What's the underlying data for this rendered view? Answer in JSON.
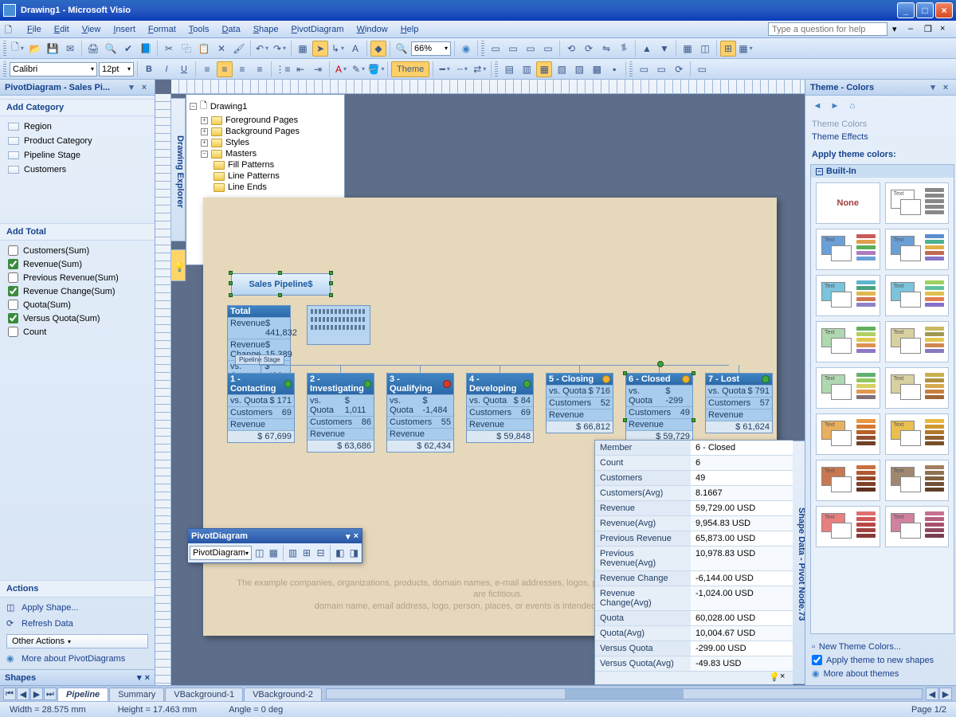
{
  "title": "Drawing1 - Microsoft Visio",
  "helpPlaceholder": "Type a question for help",
  "menus": [
    "File",
    "Edit",
    "View",
    "Insert",
    "Format",
    "Tools",
    "Data",
    "Shape",
    "PivotDiagram",
    "Window",
    "Help"
  ],
  "font": {
    "name": "Calibri",
    "size": "12pt"
  },
  "zoom": "66%",
  "themeBtn": "Theme",
  "leftPane": {
    "title": "PivotDiagram - Sales Pi...",
    "addCategory": "Add Category",
    "categories": [
      "Region",
      "Product Category",
      "Pipeline Stage",
      "Customers"
    ],
    "addTotal": "Add Total",
    "totals": [
      {
        "label": "Customers(Sum)",
        "checked": false
      },
      {
        "label": "Revenue(Sum)",
        "checked": true
      },
      {
        "label": "Previous Revenue(Sum)",
        "checked": false
      },
      {
        "label": "Revenue Change(Sum)",
        "checked": true
      },
      {
        "label": "Quota(Sum)",
        "checked": false
      },
      {
        "label": "Versus Quota(Sum)",
        "checked": true
      },
      {
        "label": "Count",
        "checked": false
      }
    ],
    "actions": "Actions",
    "applyShape": "Apply Shape...",
    "refresh": "Refresh Data",
    "otherActions": "Other Actions",
    "more": "More about PivotDiagrams",
    "shapes": "Shapes"
  },
  "explorer": {
    "root": "Drawing1",
    "items": [
      "Foreground Pages",
      "Background Pages",
      "Styles",
      "Masters"
    ],
    "subitems": [
      "Fill Patterns",
      "Line Patterns",
      "Line Ends"
    ]
  },
  "sideTab": "Drawing Explorer",
  "diagram": {
    "title": "Sales Pipeline$",
    "total": {
      "head": "Total",
      "rows": [
        [
          "Revenue",
          "$ 441,832"
        ],
        [
          "Revenue Change",
          "$ 15,389"
        ],
        [
          "vs. Quota",
          "$ -492"
        ]
      ]
    },
    "stageLabel": "Pipeline Stage",
    "nodes": [
      {
        "head": "1 - Contacting",
        "badge": "ok",
        "rows": [
          [
            "vs. Quota",
            "$ 171"
          ],
          [
            "Customers",
            "69"
          ]
        ],
        "foot": "$ 67,699"
      },
      {
        "head": "2 - Investigating",
        "badge": "ok",
        "rows": [
          [
            "vs. Quota",
            "$ 1,011"
          ],
          [
            "Customers",
            "86"
          ]
        ],
        "foot": "$ 63,686"
      },
      {
        "head": "3 - Qualifying",
        "badge": "bad",
        "rows": [
          [
            "vs. Quota",
            "$ -1,484"
          ],
          [
            "Customers",
            "55"
          ]
        ],
        "foot": "$ 62,434"
      },
      {
        "head": "4 - Developing",
        "badge": "ok",
        "rows": [
          [
            "vs. Quota",
            "$ 84"
          ],
          [
            "Customers",
            "69"
          ]
        ],
        "foot": "$ 59,848"
      },
      {
        "head": "5 - Closing",
        "badge": "warn",
        "rows": [
          [
            "vs. Quota",
            "$ 716"
          ],
          [
            "Customers",
            "52"
          ]
        ],
        "foot": "$ 66,812"
      },
      {
        "head": "6 - Closed",
        "badge": "warn",
        "rows": [
          [
            "vs. Quota",
            "$ -299"
          ],
          [
            "Customers",
            "49"
          ]
        ],
        "foot": "$ 59,729"
      },
      {
        "head": "7 - Lost",
        "badge": "ok",
        "rows": [
          [
            "vs. Quota",
            "$ 791"
          ],
          [
            "Customers",
            "57"
          ]
        ],
        "foot": "$ 61,624"
      }
    ],
    "footnote1": "The example companies, organizations, products, domain names, e-mail addresses, logos, people, places, and events depicted herein are fictitious.",
    "footnote2": "domain name, email address, logo, person, places, or events is intended or should be inferred."
  },
  "pdToolbar": {
    "title": "PivotDiagram",
    "select": "PivotDiagram"
  },
  "shapeData": {
    "title": "Shape Data - Pivot Node.73",
    "rows": [
      [
        "Member",
        "6 - Closed"
      ],
      [
        "Count",
        "6"
      ],
      [
        "Customers",
        "49"
      ],
      [
        "Customers(Avg)",
        "8.1667"
      ],
      [
        "Revenue",
        "59,729.00 USD"
      ],
      [
        "Revenue(Avg)",
        "9,954.83 USD"
      ],
      [
        "Previous Revenue",
        "65,873.00 USD"
      ],
      [
        "Previous Revenue(Avg)",
        "10,978.83 USD"
      ],
      [
        "Revenue Change",
        "-6,144.00 USD"
      ],
      [
        "Revenue Change(Avg)",
        "-1,024.00 USD"
      ],
      [
        "Quota",
        "60,028.00 USD"
      ],
      [
        "Quota(Avg)",
        "10,004.67 USD"
      ],
      [
        "Versus Quota",
        "-299.00 USD"
      ],
      [
        "Versus Quota(Avg)",
        "-49.83 USD"
      ]
    ]
  },
  "tabs": [
    "Pipeline",
    "Summary",
    "VBackground-1",
    "VBackground-2"
  ],
  "themePane": {
    "title": "Theme - Colors",
    "links": [
      "Theme Colors",
      "Theme Effects"
    ],
    "apply": "Apply theme colors:",
    "group": "Built-In",
    "none": "None",
    "newTheme": "New Theme Colors...",
    "applyNew": "Apply theme to new shapes",
    "more": "More about themes",
    "swatches": [
      {
        "box": "#ffffff",
        "bars": [
          "#888",
          "#888",
          "#888",
          "#888",
          "#888"
        ]
      },
      {
        "box": "#6aa0d8",
        "bars": [
          "#c85a5a",
          "#e0a050",
          "#5aae5a",
          "#b07ac0",
          "#6aa0d8"
        ]
      },
      {
        "box": "#6aa0d8",
        "bars": [
          "#5a8dd0",
          "#4fb090",
          "#e4b04a",
          "#c06a50",
          "#8874c4"
        ]
      },
      {
        "box": "#7cc3dc",
        "bars": [
          "#60b5cc",
          "#4aa080",
          "#e0b850",
          "#d07850",
          "#9080c8"
        ]
      },
      {
        "box": "#7cc3dc",
        "bars": [
          "#a0d060",
          "#60c0a0",
          "#e0c050",
          "#e08050",
          "#8870c8"
        ]
      },
      {
        "box": "#b0d8b0",
        "bars": [
          "#60b060",
          "#b0d060",
          "#e0c850",
          "#e09050",
          "#9078c8"
        ]
      },
      {
        "box": "#d8d0a0",
        "bars": [
          "#c8b860",
          "#a09850",
          "#e0c850",
          "#d08850",
          "#8878c0"
        ]
      },
      {
        "box": "#b0d8b0",
        "bars": [
          "#60b070",
          "#90c860",
          "#d8d060",
          "#e09850",
          "#807078"
        ]
      },
      {
        "box": "#d8d0a0",
        "bars": [
          "#c8b050",
          "#b09040",
          "#d8a850",
          "#c88040",
          "#a06838"
        ]
      },
      {
        "box": "#e8b060",
        "bars": [
          "#e89840",
          "#d87830",
          "#b86028",
          "#905030",
          "#704028"
        ]
      },
      {
        "box": "#e8c050",
        "bars": [
          "#e8b840",
          "#d09830",
          "#b07828",
          "#906030",
          "#785028"
        ]
      },
      {
        "box": "#c87850",
        "bars": [
          "#c87040",
          "#b05830",
          "#984828",
          "#804028",
          "#603020"
        ]
      },
      {
        "box": "#a08870",
        "bars": [
          "#a08060",
          "#907050",
          "#806040",
          "#705038",
          "#604028"
        ]
      },
      {
        "box": "#e88080",
        "bars": [
          "#e07070",
          "#d05858",
          "#b84848",
          "#a04040",
          "#883838"
        ]
      },
      {
        "box": "#d080a0",
        "bars": [
          "#c87090",
          "#b86080",
          "#a85070",
          "#904860",
          "#784050"
        ]
      }
    ]
  },
  "status": {
    "w": "Width = 28.575 mm",
    "h": "Height = 17.463 mm",
    "a": "Angle = 0 deg",
    "page": "Page 1/2"
  }
}
